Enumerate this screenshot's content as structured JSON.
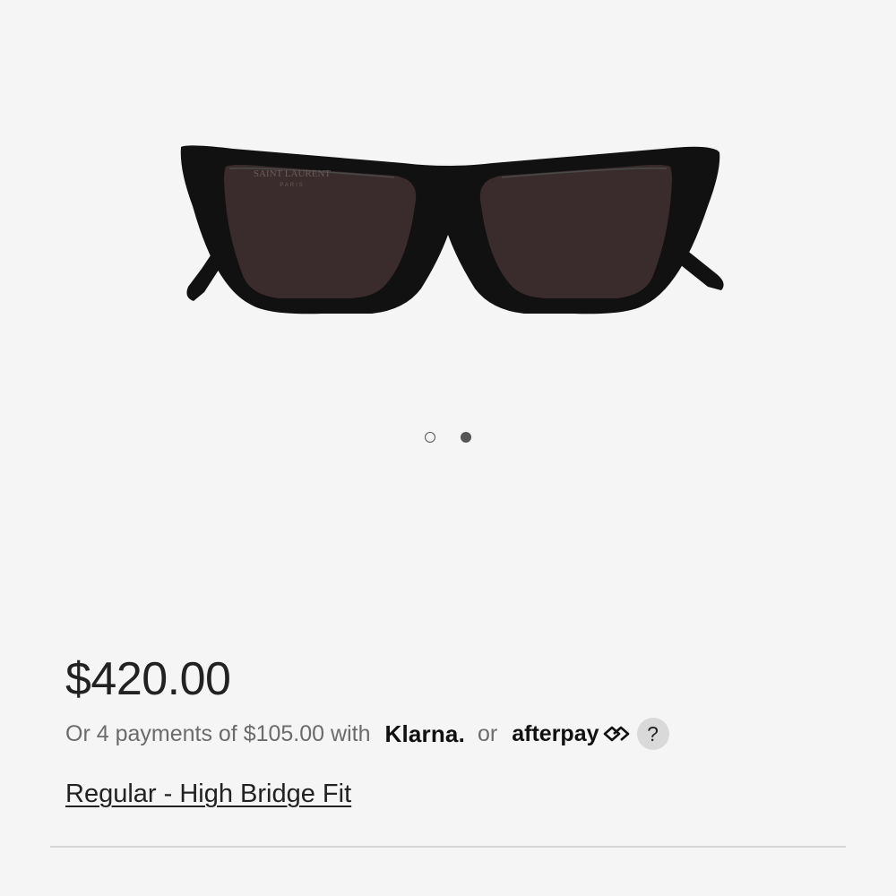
{
  "product": {
    "image_alt": "Saint Laurent cat-eye sunglasses",
    "brand_mark_line1": "SAINT LAURENT",
    "brand_mark_line2": "PARIS",
    "carousel": {
      "total": 2,
      "active_index": 1
    },
    "price": "$420.00",
    "installments": {
      "prefix": "Or 4 payments of $105.00 with",
      "klarna_label": "Klarna.",
      "or_label": "or",
      "afterpay_label": "afterpay",
      "help_label": "?"
    },
    "fit_link": "Regular - High Bridge Fit"
  },
  "colors": {
    "background": "#f5f5f5",
    "frame": "#111111",
    "lens": "#3a2c2c",
    "text": "#222222",
    "muted_text": "#6b6b6b"
  },
  "icons": {
    "afterpay": "afterpay-arrows-icon",
    "help": "question-mark-icon"
  }
}
